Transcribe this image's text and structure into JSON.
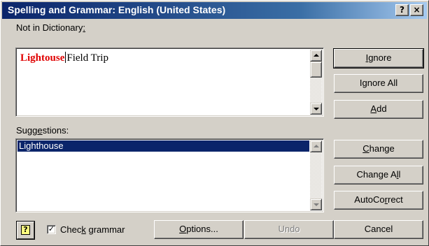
{
  "window": {
    "title": "Spelling and Grammar: English (United States)",
    "help_button": "?",
    "close_button": "×"
  },
  "not_in_dictionary": {
    "label_before": "Not in Dictionary",
    "label_key": ":",
    "error_word": "Lightouse",
    "rest_text": "Field Trip"
  },
  "suggestions": {
    "label_before": "Sugg",
    "label_key": "e",
    "label_after": "stions:",
    "items": [
      "Lighthouse"
    ],
    "selected_index": 0
  },
  "buttons": {
    "ignore": {
      "key": "I",
      "rest": "gnore"
    },
    "ignore_all": {
      "before": "I",
      "key": "g",
      "after": "nore All"
    },
    "add": {
      "key": "A",
      "rest": "dd"
    },
    "change": {
      "key": "C",
      "rest": "hange"
    },
    "change_all": {
      "before": "Change A",
      "key": "l",
      "after": "l"
    },
    "autocorrect": {
      "before": "AutoCo",
      "key": "r",
      "after": "rect"
    },
    "options": {
      "key": "O",
      "rest": "ptions..."
    },
    "undo": {
      "label": "Undo",
      "enabled": false
    },
    "cancel": {
      "label": "Cancel"
    }
  },
  "check_grammar": {
    "before": "Chec",
    "key": "k",
    "after": " grammar",
    "checked": true,
    "check_glyph": "✓"
  },
  "office_assistant": {
    "glyph": "?"
  },
  "colors": {
    "title_bar": "#0a246a",
    "error_text": "#e00000",
    "selection": "#0a246a",
    "face": "#d4d0c8"
  }
}
